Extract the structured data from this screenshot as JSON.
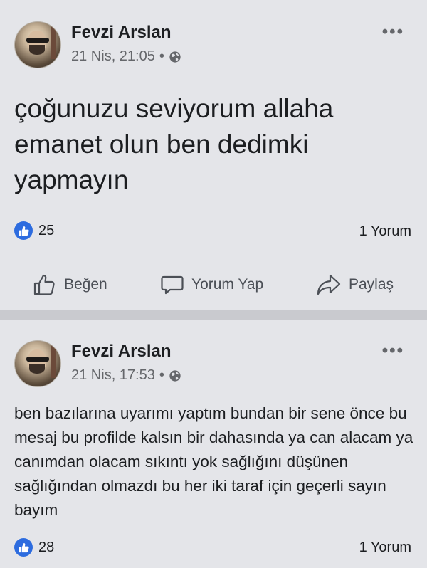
{
  "posts": [
    {
      "author": "Fevzi Arslan",
      "timestamp": "21 Nis, 21:05",
      "separator": "•",
      "text": "çoğunuzu seviyorum allaha emanet olun ben dedimki yapmayın",
      "likes": "25",
      "comments": "1 Yorum"
    },
    {
      "author": "Fevzi Arslan",
      "timestamp": "21 Nis, 17:53",
      "separator": "•",
      "text": "ben bazılarına uyarımı yaptım bundan bir sene önce bu mesaj bu profilde kalsın bir dahasında ya can alacam ya canımdan olacam sıkıntı yok sağlığını düşünen sağlığından olmazdı bu her iki taraf için geçerli sayın bayım",
      "likes": "28",
      "comments": "1 Yorum"
    }
  ],
  "actions": {
    "like": "Beğen",
    "comment": "Yorum Yap",
    "share": "Paylaş"
  },
  "more_glyph": "•••",
  "icons": {
    "privacy": "globe-icon",
    "like": "thumbs-up-icon",
    "comment": "speech-bubble-icon",
    "share": "share-arrow-icon",
    "more": "more-options-icon"
  },
  "colors": {
    "like_blue": "#2d6cdf",
    "card_bg": "#e4e5e9",
    "muted_text": "#65676b"
  }
}
